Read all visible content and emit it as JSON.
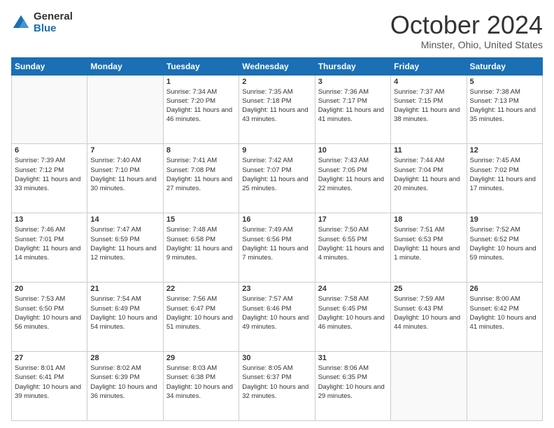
{
  "header": {
    "logo": {
      "general": "General",
      "blue": "Blue"
    },
    "title": "October 2024",
    "location": "Minster, Ohio, United States"
  },
  "weekdays": [
    "Sunday",
    "Monday",
    "Tuesday",
    "Wednesday",
    "Thursday",
    "Friday",
    "Saturday"
  ],
  "weeks": [
    [
      {
        "day": "",
        "empty": true
      },
      {
        "day": "",
        "empty": true
      },
      {
        "day": "1",
        "sunrise": "7:34 AM",
        "sunset": "7:20 PM",
        "daylight": "11 hours and 46 minutes."
      },
      {
        "day": "2",
        "sunrise": "7:35 AM",
        "sunset": "7:18 PM",
        "daylight": "11 hours and 43 minutes."
      },
      {
        "day": "3",
        "sunrise": "7:36 AM",
        "sunset": "7:17 PM",
        "daylight": "11 hours and 41 minutes."
      },
      {
        "day": "4",
        "sunrise": "7:37 AM",
        "sunset": "7:15 PM",
        "daylight": "11 hours and 38 minutes."
      },
      {
        "day": "5",
        "sunrise": "7:38 AM",
        "sunset": "7:13 PM",
        "daylight": "11 hours and 35 minutes."
      }
    ],
    [
      {
        "day": "6",
        "sunrise": "7:39 AM",
        "sunset": "7:12 PM",
        "daylight": "11 hours and 33 minutes."
      },
      {
        "day": "7",
        "sunrise": "7:40 AM",
        "sunset": "7:10 PM",
        "daylight": "11 hours and 30 minutes."
      },
      {
        "day": "8",
        "sunrise": "7:41 AM",
        "sunset": "7:08 PM",
        "daylight": "11 hours and 27 minutes."
      },
      {
        "day": "9",
        "sunrise": "7:42 AM",
        "sunset": "7:07 PM",
        "daylight": "11 hours and 25 minutes."
      },
      {
        "day": "10",
        "sunrise": "7:43 AM",
        "sunset": "7:05 PM",
        "daylight": "11 hours and 22 minutes."
      },
      {
        "day": "11",
        "sunrise": "7:44 AM",
        "sunset": "7:04 PM",
        "daylight": "11 hours and 20 minutes."
      },
      {
        "day": "12",
        "sunrise": "7:45 AM",
        "sunset": "7:02 PM",
        "daylight": "11 hours and 17 minutes."
      }
    ],
    [
      {
        "day": "13",
        "sunrise": "7:46 AM",
        "sunset": "7:01 PM",
        "daylight": "11 hours and 14 minutes."
      },
      {
        "day": "14",
        "sunrise": "7:47 AM",
        "sunset": "6:59 PM",
        "daylight": "11 hours and 12 minutes."
      },
      {
        "day": "15",
        "sunrise": "7:48 AM",
        "sunset": "6:58 PM",
        "daylight": "11 hours and 9 minutes."
      },
      {
        "day": "16",
        "sunrise": "7:49 AM",
        "sunset": "6:56 PM",
        "daylight": "11 hours and 7 minutes."
      },
      {
        "day": "17",
        "sunrise": "7:50 AM",
        "sunset": "6:55 PM",
        "daylight": "11 hours and 4 minutes."
      },
      {
        "day": "18",
        "sunrise": "7:51 AM",
        "sunset": "6:53 PM",
        "daylight": "11 hours and 1 minute."
      },
      {
        "day": "19",
        "sunrise": "7:52 AM",
        "sunset": "6:52 PM",
        "daylight": "10 hours and 59 minutes."
      }
    ],
    [
      {
        "day": "20",
        "sunrise": "7:53 AM",
        "sunset": "6:50 PM",
        "daylight": "10 hours and 56 minutes."
      },
      {
        "day": "21",
        "sunrise": "7:54 AM",
        "sunset": "6:49 PM",
        "daylight": "10 hours and 54 minutes."
      },
      {
        "day": "22",
        "sunrise": "7:56 AM",
        "sunset": "6:47 PM",
        "daylight": "10 hours and 51 minutes."
      },
      {
        "day": "23",
        "sunrise": "7:57 AM",
        "sunset": "6:46 PM",
        "daylight": "10 hours and 49 minutes."
      },
      {
        "day": "24",
        "sunrise": "7:58 AM",
        "sunset": "6:45 PM",
        "daylight": "10 hours and 46 minutes."
      },
      {
        "day": "25",
        "sunrise": "7:59 AM",
        "sunset": "6:43 PM",
        "daylight": "10 hours and 44 minutes."
      },
      {
        "day": "26",
        "sunrise": "8:00 AM",
        "sunset": "6:42 PM",
        "daylight": "10 hours and 41 minutes."
      }
    ],
    [
      {
        "day": "27",
        "sunrise": "8:01 AM",
        "sunset": "6:41 PM",
        "daylight": "10 hours and 39 minutes."
      },
      {
        "day": "28",
        "sunrise": "8:02 AM",
        "sunset": "6:39 PM",
        "daylight": "10 hours and 36 minutes."
      },
      {
        "day": "29",
        "sunrise": "8:03 AM",
        "sunset": "6:38 PM",
        "daylight": "10 hours and 34 minutes."
      },
      {
        "day": "30",
        "sunrise": "8:05 AM",
        "sunset": "6:37 PM",
        "daylight": "10 hours and 32 minutes."
      },
      {
        "day": "31",
        "sunrise": "8:06 AM",
        "sunset": "6:35 PM",
        "daylight": "10 hours and 29 minutes."
      },
      {
        "day": "",
        "empty": true
      },
      {
        "day": "",
        "empty": true
      }
    ]
  ],
  "labels": {
    "sunrise_prefix": "Sunrise: ",
    "sunset_prefix": "Sunset: ",
    "daylight_prefix": "Daylight: "
  }
}
